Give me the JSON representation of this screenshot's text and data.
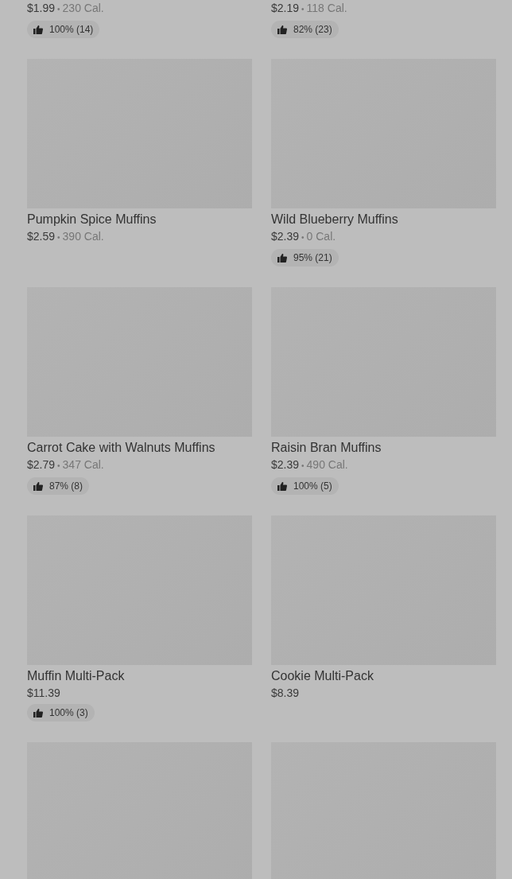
{
  "separator": "•",
  "items": [
    {
      "price": "$1.99",
      "calories": "230 Cal.",
      "rating": "100% (14)"
    },
    {
      "price": "$2.19",
      "calories": "118 Cal.",
      "rating": "82% (23)"
    },
    {
      "kind": "picture",
      "name": "Pumpkin Spice Muffins",
      "price": "$2.59",
      "calories": "390 Cal."
    },
    {
      "kind": "picture",
      "name": "Wild Blueberry Muffins",
      "price": "$2.39",
      "calories": "0 Cal.",
      "rating": "95% (21)"
    },
    {
      "kind": "picture",
      "name": "Carrot Cake with Walnuts Muffins",
      "price": "$2.79",
      "calories": "347 Cal.",
      "rating": "87% (8)"
    },
    {
      "kind": "picture",
      "name": "Raisin Bran Muffins",
      "price": "$2.39",
      "calories": "490 Cal.",
      "rating": "100% (5)"
    },
    {
      "kind": "picture",
      "name": "Muffin Multi-Pack",
      "price": "$11.39",
      "rating": "100% (3)"
    },
    {
      "kind": "picture",
      "name": "Cookie Multi-Pack",
      "price": "$8.39"
    },
    {
      "kind": "picture"
    },
    {
      "kind": "picture"
    }
  ]
}
